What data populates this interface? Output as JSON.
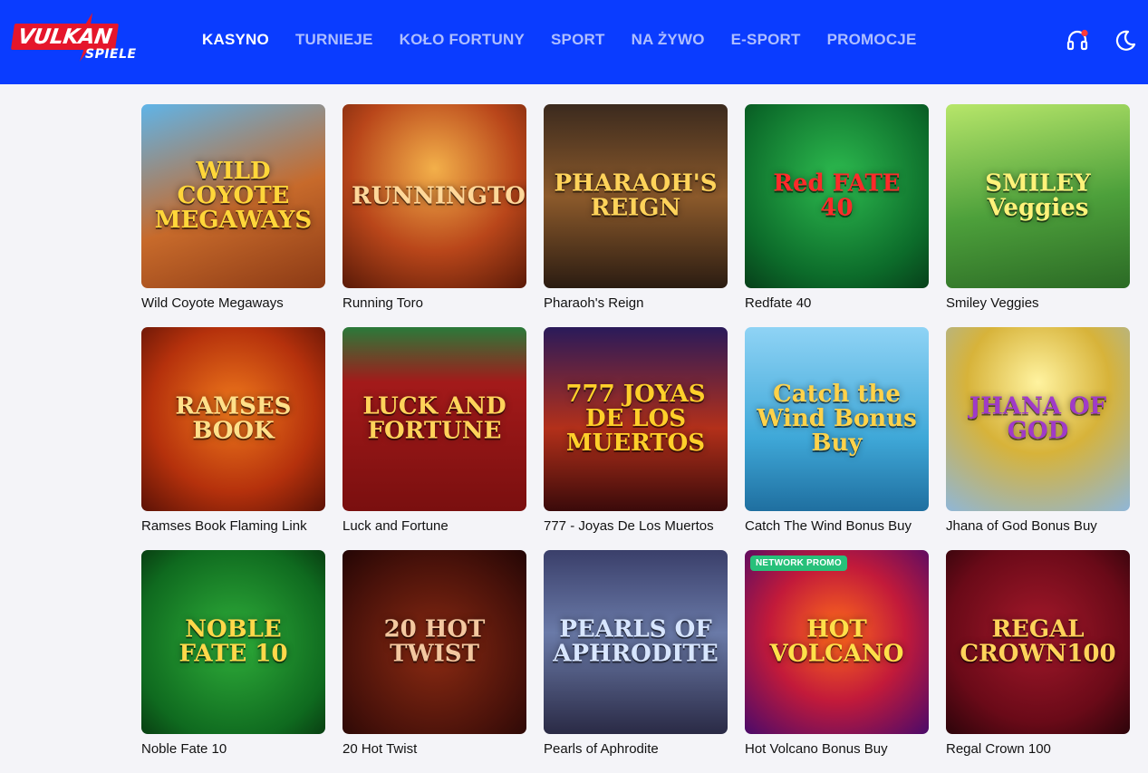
{
  "brand": {
    "name": "VULKAN",
    "sub": "SPIELE"
  },
  "nav": [
    "KASYNO",
    "TURNIEJE",
    "KOŁO FORTUNY",
    "SPORT",
    "NA ŻYWO",
    "E-SPORT",
    "PROMOCJE"
  ],
  "active_nav": "KASYNO",
  "header_icons": [
    "support-headset-icon",
    "dark-mode-moon-icon"
  ],
  "colors": {
    "header": "#0a3cff",
    "page": "#f4f4f8",
    "badge": "#27c07a"
  },
  "games": [
    {
      "name": "Wild Coyote Megaways",
      "art_title": "WILD COYOTE MEGAWAYS",
      "bg": "linear-gradient(160deg,#5fb4e8 0%,#c76a2b 55%,#8c3a15 100%)",
      "fg": "#ffd63a"
    },
    {
      "name": "Running Toro",
      "art_title": "RUNNINGTORO",
      "bg": "radial-gradient(circle at 50% 35%,#f3b04a 0%,#b9461a 55%,#5a1a08 100%)",
      "fg": "#ffd89a"
    },
    {
      "name": "Pharaoh's Reign",
      "art_title": "PHARAOH'S REIGN",
      "bg": "linear-gradient(180deg,#3b2a1e 0%,#8c5a2b 50%,#2b1c12 100%)",
      "fg": "#ffd35a"
    },
    {
      "name": "Redfate 40",
      "art_title": "Red FATE 40",
      "bg": "radial-gradient(circle at 50% 40%,#2dbb4f 0%,#0c6b2a 70%,#07401a 100%)",
      "fg": "#ff2a2a"
    },
    {
      "name": "Smiley Veggies",
      "art_title": "SMILEY Veggies",
      "bg": "linear-gradient(170deg,#b7e66a 0%,#4da03b 55%,#2b6a25 100%)",
      "fg": "#fff27a"
    },
    {
      "name": "Ramses Book Flaming Link",
      "art_title": "RAMSES BOOK",
      "bg": "radial-gradient(circle at 50% 45%,#f07a1c 0%,#b5310c 60%,#5c1206 100%)",
      "fg": "#ffe08a"
    },
    {
      "name": "Luck and Fortune",
      "art_title": "LUCK AND FORTUNE",
      "bg": "linear-gradient(180deg,#2a7a3a 0%,#a31a1a 30%,#7a0f0f 100%)",
      "fg": "#ffd35a"
    },
    {
      "name": "777 - Joyas De Los Muertos",
      "art_title": "777 JOYAS DE LOS MUERTOS",
      "bg": "linear-gradient(180deg,#2a1a5a 0%,#b3301a 55%,#3a0a0a 100%)",
      "fg": "#ffcf2a"
    },
    {
      "name": "Catch The Wind Bonus Buy",
      "art_title": "Catch the Wind Bonus Buy",
      "bg": "linear-gradient(180deg,#8fd3f5 0%,#3fa8d8 60%,#1f6fa0 100%)",
      "fg": "#ffd24a"
    },
    {
      "name": "Jhana of God Bonus Buy",
      "art_title": "JHANA OF GOD",
      "bg": "radial-gradient(circle at 50% 30%,#fff3a0 0%,#d7b33a 45%,#8fb6d8 100%)",
      "fg": "#a03ac8"
    },
    {
      "name": "Noble Fate 10",
      "art_title": "NOBLE FATE 10",
      "bg": "radial-gradient(circle at 50% 50%,#2fae3a 0%,#0f6a1f 75%,#093f12 100%)",
      "fg": "#ffd84a"
    },
    {
      "name": "20 Hot Twist",
      "art_title": "20 HOT TWIST",
      "bg": "radial-gradient(circle at 50% 55%,#8a2a12 0%,#4a120a 65%,#240605 100%)",
      "fg": "#f3c8a0"
    },
    {
      "name": "Pearls of Aphrodite",
      "art_title": "PEARLS OF APHRODITE",
      "bg": "linear-gradient(180deg,#3a3f6a 0%,#6a7aa8 45%,#2a2a45 100%)",
      "fg": "#d8e6ff"
    },
    {
      "name": "Hot Volcano Bonus Buy",
      "art_title": "HOT VOLCANO",
      "bg": "radial-gradient(circle at 50% 45%,#ff6a1a 0%,#c21a3a 50%,#4a0a6a 100%)",
      "fg": "#ffe04a",
      "badge": "NETWORK PROMO"
    },
    {
      "name": "Regal Crown 100",
      "art_title": "REGAL CROWN100",
      "bg": "radial-gradient(circle at 50% 45%,#a3182a 0%,#6a0a18 65%,#2c040a 100%)",
      "fg": "#ffd35a"
    }
  ]
}
